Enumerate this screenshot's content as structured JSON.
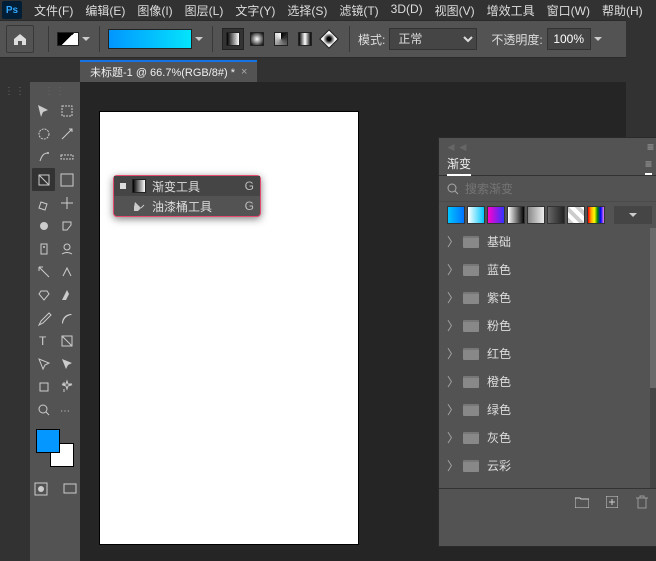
{
  "menubar": {
    "items": [
      "文件(F)",
      "编辑(E)",
      "图像(I)",
      "图层(L)",
      "文字(Y)",
      "选择(S)",
      "滤镜(T)",
      "3D(D)",
      "视图(V)",
      "增效工具",
      "窗口(W)",
      "帮助(H)"
    ]
  },
  "optionsbar": {
    "mode_label": "模式:",
    "mode_value": "正常",
    "opacity_label": "不透明度:",
    "opacity_value": "100%"
  },
  "tab": {
    "title": "未标题-1 @ 66.7%(RGB/8#) *",
    "close": "×"
  },
  "flyout": {
    "items": [
      {
        "label": "渐变工具",
        "key": "G",
        "selected": true,
        "icon": "gradient"
      },
      {
        "label": "油漆桶工具",
        "key": "G",
        "selected": false,
        "icon": "bucket"
      }
    ]
  },
  "panel": {
    "title": "渐变",
    "search_placeholder": "搜索渐变",
    "folders": [
      "基础",
      "蓝色",
      "紫色",
      "粉色",
      "红色",
      "橙色",
      "绿色",
      "灰色",
      "云彩"
    ],
    "preset_gradients": [
      "linear-gradient(90deg,#00c6ff,#0072ff)",
      "linear-gradient(90deg,#fff,#00c6ff)",
      "linear-gradient(90deg,#ff00cc,#3333ff)",
      "linear-gradient(90deg,#fff,#000)",
      "linear-gradient(90deg,#888,#eee)",
      "linear-gradient(90deg,#666,#222)",
      "repeating-linear-gradient(45deg,#ccc 0 4px,#fff 4px 8px)",
      "linear-gradient(90deg,red,orange,yellow,green,blue,violet)"
    ]
  },
  "logo": "Ps"
}
